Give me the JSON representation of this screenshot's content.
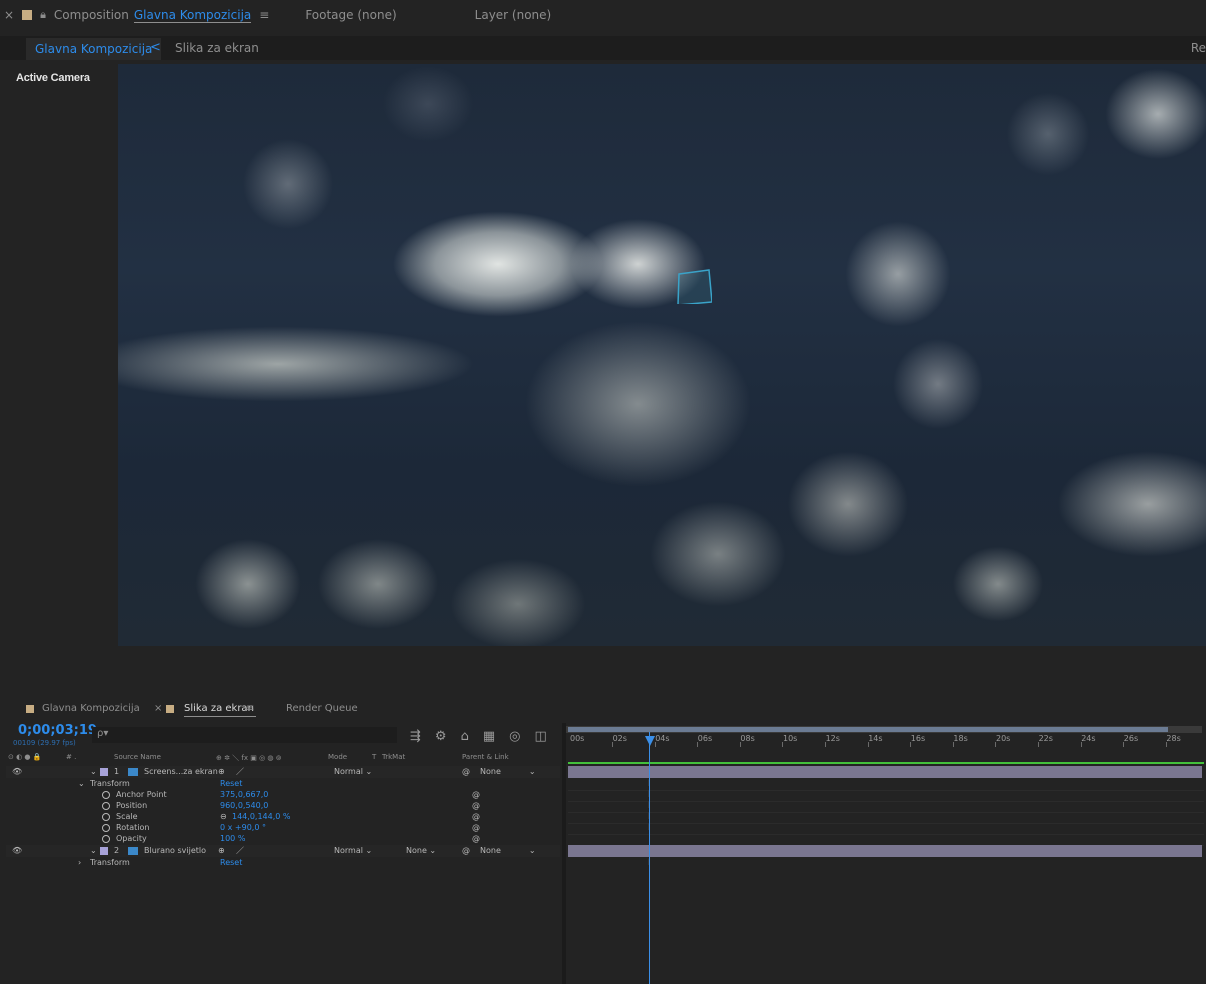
{
  "comp_header": {
    "close": "×",
    "lock_icon": "lock-icon",
    "label": "Composition",
    "comp_name": "Glavna Kompozicija",
    "menu": "≡",
    "footage": "Footage (none)",
    "layer": "Layer (none)"
  },
  "comp_tabs": {
    "active": "Glavna Kompozicija",
    "arrow": "<",
    "next": "Slika za ekran",
    "right_cut": "Re"
  },
  "viewer": {
    "camera_label": "Active Camera"
  },
  "timeline_tabs": {
    "tab1": "Glavna Kompozicija",
    "tab2_close": "×",
    "tab2": "Slika za ekran",
    "tab2_menu": "≡",
    "tab3": "Render Queue"
  },
  "timeline": {
    "timecode": "0;00;03;19",
    "fps": "00109 (29.97 fps)",
    "search_placeholder": "ρ▾",
    "columns": {
      "switches": "⊙ ◐ ● 🔒",
      "label": "# .",
      "source": "Source Name",
      "switch_icons": "⊕ ✲ ＼ fx ▣ ◎ ◍ ⊚",
      "mode": "Mode",
      "t": "T",
      "trkmat": "TrkMat",
      "parent": "Parent & Link"
    },
    "layers": [
      {
        "num": "1",
        "name": "Screens...za ekran",
        "mode": "Normal",
        "trkmat": "",
        "parent": "None",
        "transform_label": "Transform",
        "reset": "Reset",
        "props": [
          {
            "name": "Anchor Point",
            "value": "375,0,667,0"
          },
          {
            "name": "Position",
            "value": "960,0,540,0"
          },
          {
            "name": "Scale",
            "value": "144,0,144,0 %"
          },
          {
            "name": "Rotation",
            "value": "0 x +90,0 °"
          },
          {
            "name": "Opacity",
            "value": "100 %"
          }
        ]
      },
      {
        "num": "2",
        "name": "Blurano svijetlo",
        "mode": "Normal",
        "trkmat": "None",
        "parent": "None",
        "transform_label": "Transform",
        "reset": "Reset"
      }
    ],
    "ruler": [
      "00s",
      "02s",
      "04s",
      "06s",
      "08s",
      "10s",
      "12s",
      "14s",
      "16s",
      "18s",
      "20s",
      "22s",
      "24s",
      "26s",
      "28s"
    ],
    "playhead_seconds": 3.63,
    "duration_seconds": 29
  },
  "colors": {
    "accent": "#2d8ceb",
    "layer_label": "#a7a2d8",
    "track": "#7a7690",
    "work_area": "#43c03b"
  }
}
